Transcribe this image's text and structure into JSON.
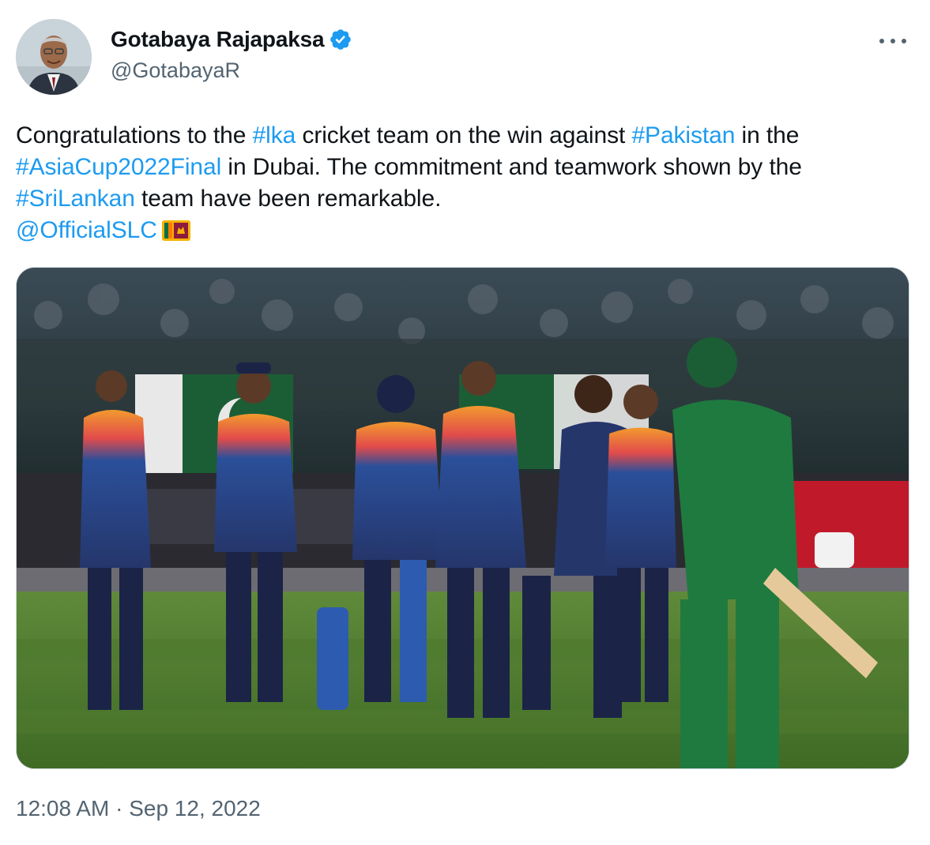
{
  "author": {
    "display_name": "Gotabaya Rajapaksa",
    "handle": "@GotabayaR",
    "verified": true,
    "avatar_icon": "profile-photo"
  },
  "tweet": {
    "text_1": "Congratulations to the ",
    "tag_lka": "#lka",
    "text_2": " cricket team on the win against ",
    "tag_pakistan": "#Pakistan",
    "text_3": " in the ",
    "tag_asiacup": "#AsiaCup2022Final",
    "text_4": " in Dubai. The commitment and teamwork shown by the ",
    "tag_srilankan": "#SriLankan",
    "text_5": " team have been remarkable.",
    "mention": "@OfficialSLC",
    "flag_icon": "sri-lanka-flag-icon"
  },
  "media": {
    "image_icon": "cricket-team-photo"
  },
  "meta": {
    "time": "12:08 AM",
    "separator": "·",
    "date": "Sep 12, 2022"
  },
  "colors": {
    "link": "#1d9bf0",
    "secondary_text": "#536471",
    "verified": "#1d9bf0"
  }
}
